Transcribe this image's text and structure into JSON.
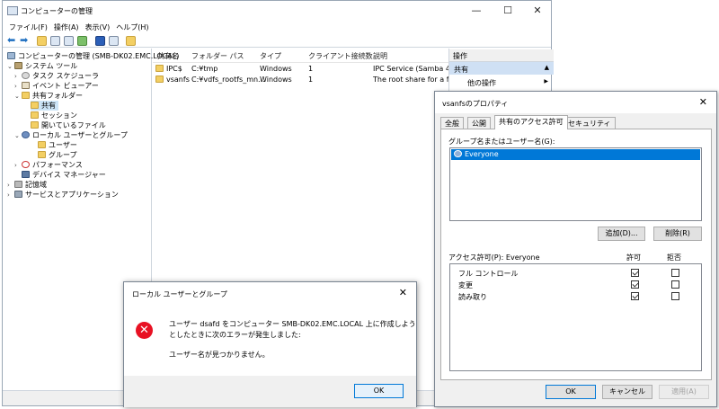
{
  "main": {
    "title": "コンピューターの管理",
    "window_controls": {
      "minimize": "—",
      "maximize": "☐",
      "close": "✕"
    },
    "menu": [
      "ファイル(F)",
      "操作(A)",
      "表示(V)",
      "ヘルプ(H)"
    ],
    "tree": [
      {
        "label": "コンピューターの管理 (SMB-DK02.EMC.LOCAL)",
        "expander": ""
      },
      {
        "label": "システム ツール",
        "expander": "⌄"
      },
      {
        "label": "タスク スケジューラ",
        "expander": "›"
      },
      {
        "label": "イベント ビューアー",
        "expander": "›"
      },
      {
        "label": "共有フォルダー",
        "expander": "⌄"
      },
      {
        "label": "共有",
        "expander": ""
      },
      {
        "label": "セッション",
        "expander": ""
      },
      {
        "label": "開いているファイル",
        "expander": ""
      },
      {
        "label": "ローカル ユーザーとグループ",
        "expander": "⌄"
      },
      {
        "label": "ユーザー",
        "expander": ""
      },
      {
        "label": "グループ",
        "expander": ""
      },
      {
        "label": "パフォーマンス",
        "expander": "›"
      },
      {
        "label": "デバイス マネージャー",
        "expander": ""
      },
      {
        "label": "記憶域",
        "expander": "›"
      },
      {
        "label": "サービスとアプリケーション",
        "expander": "›"
      }
    ],
    "columns": [
      "共有名",
      "フォルダー パス",
      "タイプ",
      "クライアント接続数",
      "説明"
    ],
    "rows": [
      [
        "IPC$",
        "C:¥tmp",
        "Windows",
        "1",
        "IPC Service (Samba 4.11.7)"
      ],
      [
        "vsanfs",
        "C:¥vdfs_rootfs_mn...",
        "Windows",
        "1",
        "The root share for a file s"
      ]
    ],
    "actions": {
      "header": "操作",
      "section": "共有",
      "section_arrow": "▲",
      "other": "他の操作",
      "other_arrow": "▶"
    }
  },
  "properties": {
    "title": "vsanfsのプロパティ",
    "close": "✕",
    "tabs": [
      "全般",
      "公開",
      "共有のアクセス許可",
      "セキュリティ"
    ],
    "group_label": "グループ名またはユーザー名(G):",
    "principals": [
      "Everyone"
    ],
    "add_button": "追加(D)...",
    "remove_button": "削除(R)",
    "perm_label": "アクセス許可(P): Everyone",
    "allow_header": "許可",
    "deny_header": "拒否",
    "permissions": [
      {
        "name": "フル コントロール",
        "allow": true,
        "deny": false
      },
      {
        "name": "変更",
        "allow": true,
        "deny": false
      },
      {
        "name": "読み取り",
        "allow": true,
        "deny": false
      }
    ],
    "ok": "OK",
    "cancel": "キャンセル",
    "apply": "適用(A)"
  },
  "error": {
    "title": "ローカル ユーザーとグループ",
    "close": "✕",
    "line1": "ユーザー dsafd をコンピューター SMB-DK02.EMC.LOCAL 上に作成しよう",
    "line2": "としたときに次のエラーが発生しました:",
    "line3": "ユーザー名が見つかりません。",
    "icon_glyph": "✕",
    "ok": "OK"
  }
}
